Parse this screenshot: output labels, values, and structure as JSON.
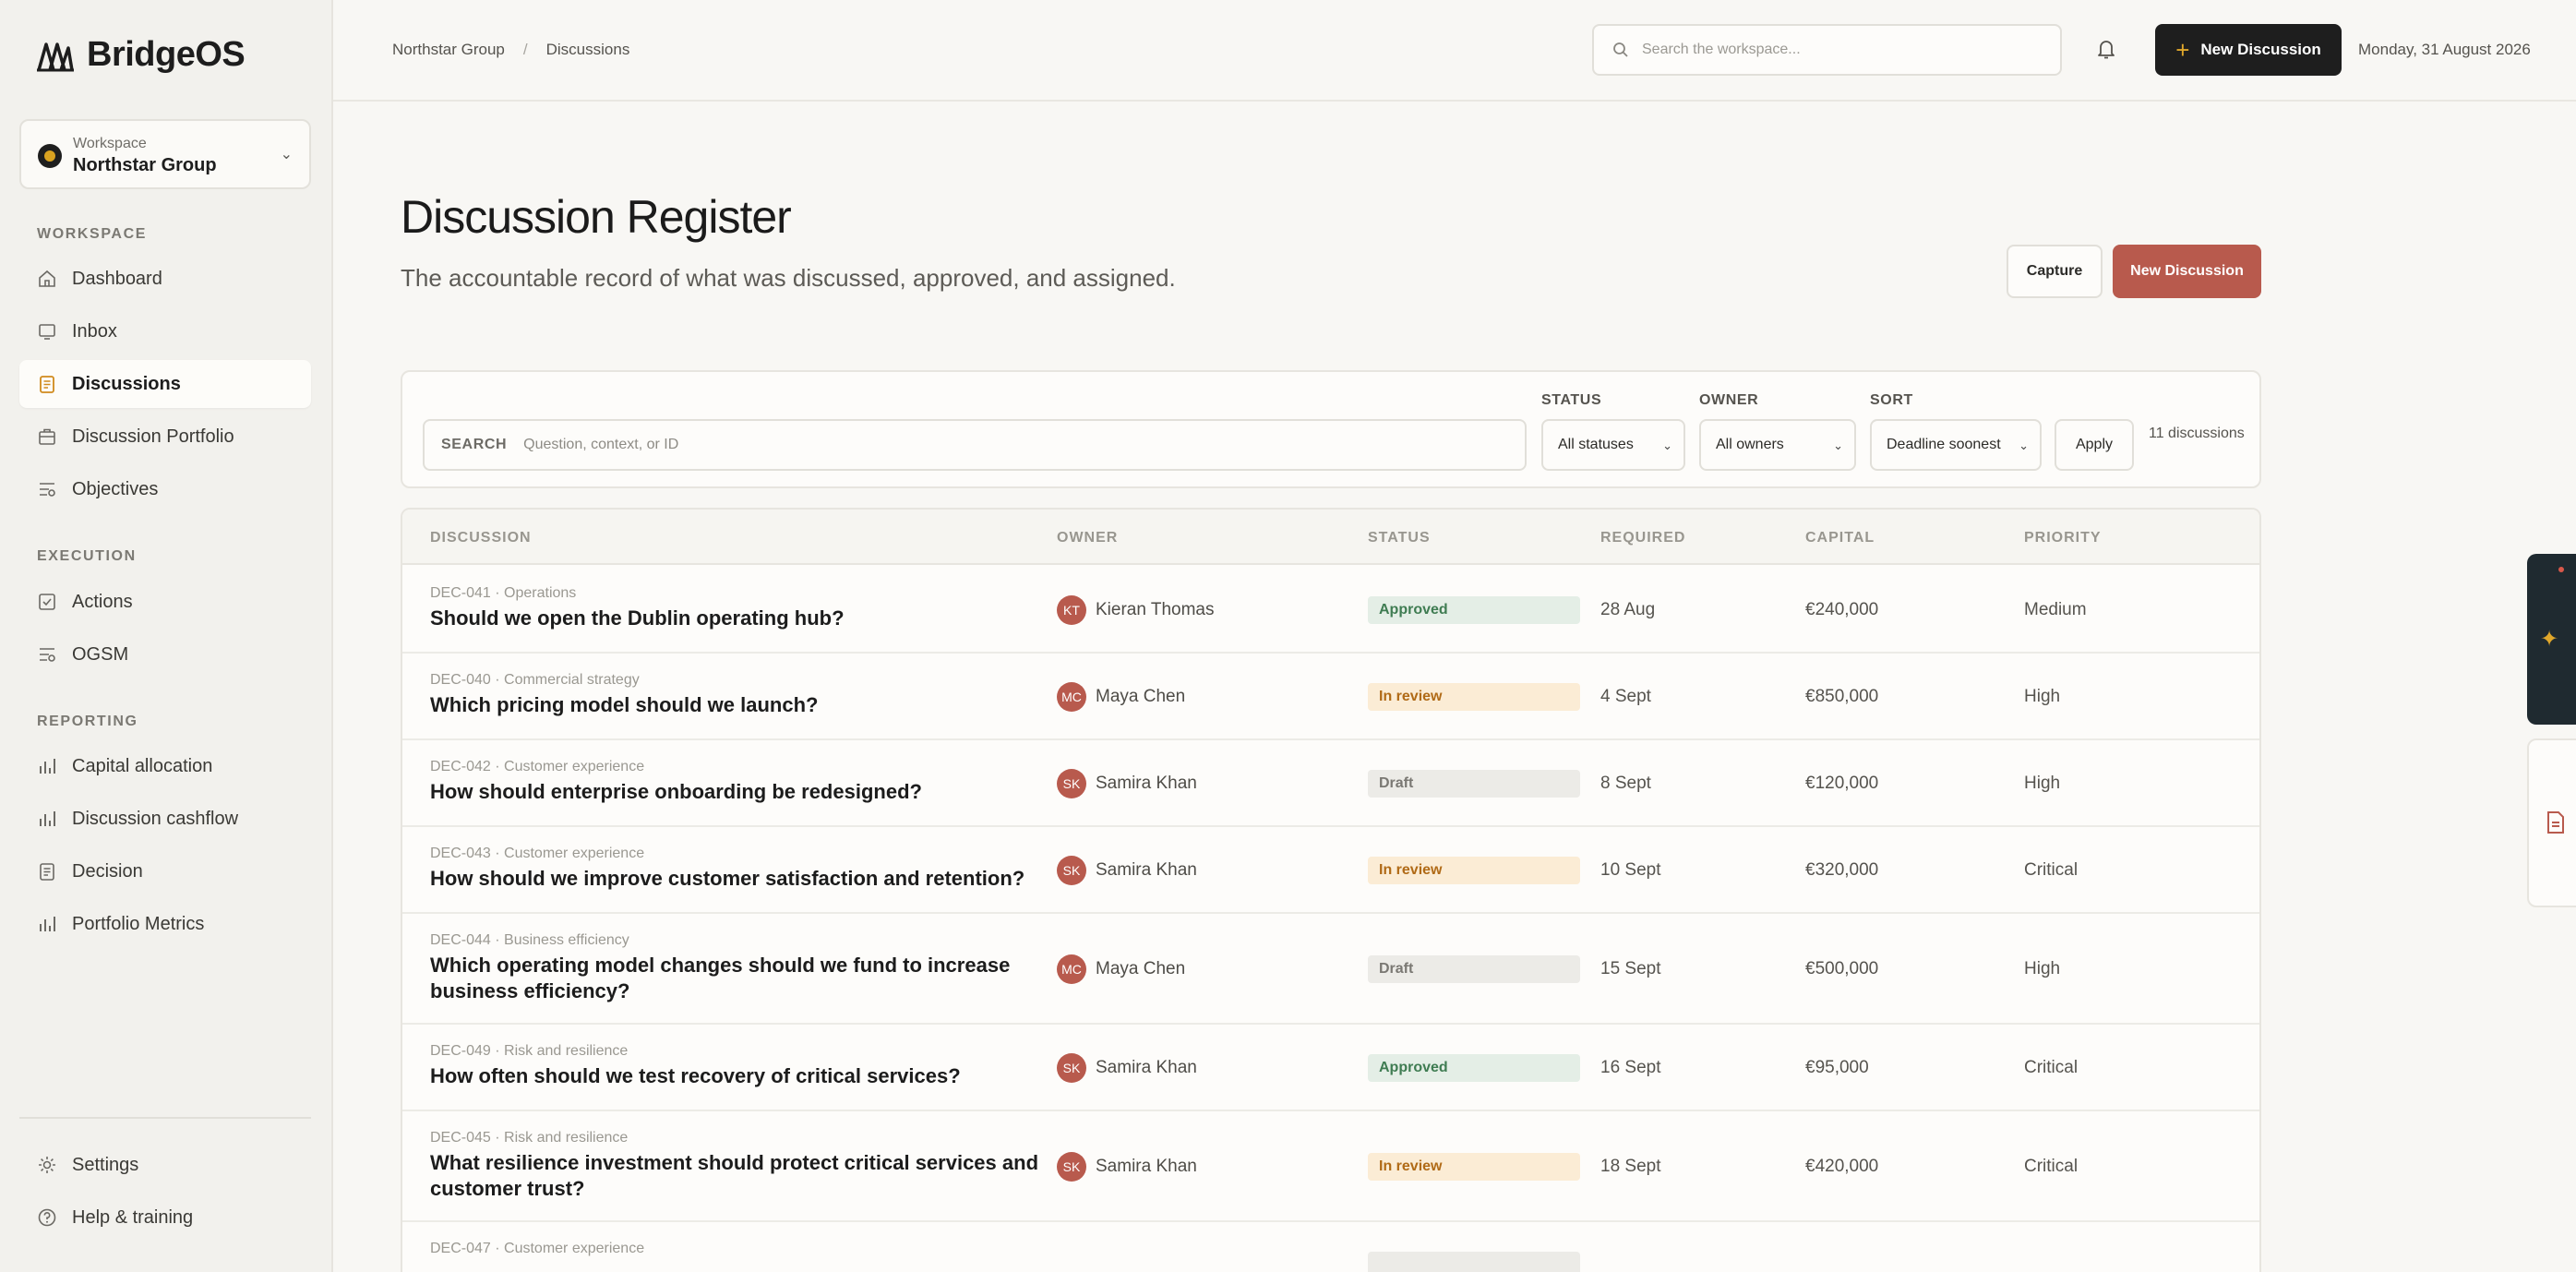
{
  "app": {
    "name": "BridgeOS"
  },
  "workspace": {
    "label": "Workspace",
    "name": "Northstar Group"
  },
  "sidebar": {
    "sections": [
      {
        "title": "WORKSPACE",
        "items": [
          {
            "label": "Dashboard",
            "icon": "home-icon"
          },
          {
            "label": "Inbox",
            "icon": "inbox-icon"
          },
          {
            "label": "Discussions",
            "icon": "document-icon",
            "active": true
          },
          {
            "label": "Discussion Portfolio",
            "icon": "briefcase-icon"
          },
          {
            "label": "Objectives",
            "icon": "objectives-icon"
          }
        ]
      },
      {
        "title": "EXECUTION",
        "items": [
          {
            "label": "Actions",
            "icon": "checkbox-icon"
          },
          {
            "label": "OGSM",
            "icon": "objectives-icon"
          }
        ]
      },
      {
        "title": "REPORTING",
        "items": [
          {
            "label": "Capital allocation",
            "icon": "bar-chart-icon"
          },
          {
            "label": "Discussion cashflow",
            "icon": "bar-chart-icon"
          },
          {
            "label": "Decision",
            "icon": "document-icon"
          },
          {
            "label": "Portfolio Metrics",
            "icon": "bar-chart-icon"
          }
        ]
      }
    ],
    "footer": [
      {
        "label": "Settings",
        "icon": "gear-icon"
      },
      {
        "label": "Help & training",
        "icon": "help-icon"
      }
    ]
  },
  "topbar": {
    "breadcrumb": [
      "Northstar Group",
      "Discussions"
    ],
    "breadcrumb_sep": "/",
    "search_placeholder": "Search the workspace...",
    "new_button": "New Discussion",
    "date": "Monday, 31 August 2026"
  },
  "header": {
    "title": "Discussion Register",
    "subtitle": "The accountable record of what was discussed, approved, and assigned.",
    "capture_button": "Capture",
    "new_button": "New Discussion"
  },
  "filters": {
    "search_label": "SEARCH",
    "search_placeholder": "Question, context, or ID",
    "status_label": "STATUS",
    "status_value": "All statuses",
    "owner_label": "OWNER",
    "owner_value": "All owners",
    "sort_label": "SORT",
    "sort_value": "Deadline soonest",
    "apply": "Apply",
    "count": "11 discussions"
  },
  "table": {
    "columns": [
      "DISCUSSION",
      "OWNER",
      "STATUS",
      "REQUIRED",
      "CAPITAL",
      "PRIORITY"
    ],
    "rows": [
      {
        "meta": "DEC-041 · Operations",
        "question": "Should we open the Dublin operating hub?",
        "initials": "KT",
        "owner": "Kieran Thomas",
        "status": "Approved",
        "status_kind": "approved",
        "required": "28 Aug",
        "capital": "€240,000",
        "priority": "Medium"
      },
      {
        "meta": "DEC-040 · Commercial strategy",
        "question": "Which pricing model should we launch?",
        "initials": "MC",
        "owner": "Maya Chen",
        "status": "In review",
        "status_kind": "review",
        "required": "4 Sept",
        "capital": "€850,000",
        "priority": "High"
      },
      {
        "meta": "DEC-042 · Customer experience",
        "question": "How should enterprise onboarding be redesigned?",
        "initials": "SK",
        "owner": "Samira Khan",
        "status": "Draft",
        "status_kind": "draft",
        "required": "8 Sept",
        "capital": "€120,000",
        "priority": "High"
      },
      {
        "meta": "DEC-043 · Customer experience",
        "question": "How should we improve customer satisfaction and retention?",
        "initials": "SK",
        "owner": "Samira Khan",
        "status": "In review",
        "status_kind": "review",
        "required": "10 Sept",
        "capital": "€320,000",
        "priority": "Critical"
      },
      {
        "meta": "DEC-044 · Business efficiency",
        "question": "Which operating model changes should we fund to increase business efficiency?",
        "initials": "MC",
        "owner": "Maya Chen",
        "status": "Draft",
        "status_kind": "draft",
        "required": "15 Sept",
        "capital": "€500,000",
        "priority": "High"
      },
      {
        "meta": "DEC-049 · Risk and resilience",
        "question": "How often should we test recovery of critical services?",
        "initials": "SK",
        "owner": "Samira Khan",
        "status": "Approved",
        "status_kind": "approved",
        "required": "16 Sept",
        "capital": "€95,000",
        "priority": "Critical"
      },
      {
        "meta": "DEC-045 · Risk and resilience",
        "question": "What resilience investment should protect critical services and customer trust?",
        "initials": "SK",
        "owner": "Samira Khan",
        "status": "In review",
        "status_kind": "review",
        "required": "18 Sept",
        "capital": "€420,000",
        "priority": "Critical"
      },
      {
        "meta": "DEC-047 · Customer experience",
        "question": "",
        "initials": "",
        "owner": "",
        "status": "",
        "status_kind": "draft",
        "required": "",
        "capital": "",
        "priority": ""
      }
    ]
  },
  "colors": {
    "accent": "#b85a4d",
    "dark": "#1e1e1e",
    "gold": "#e0a72b",
    "approved": "#3f7c52",
    "review": "#b06a16",
    "draft": "#7a7873"
  }
}
